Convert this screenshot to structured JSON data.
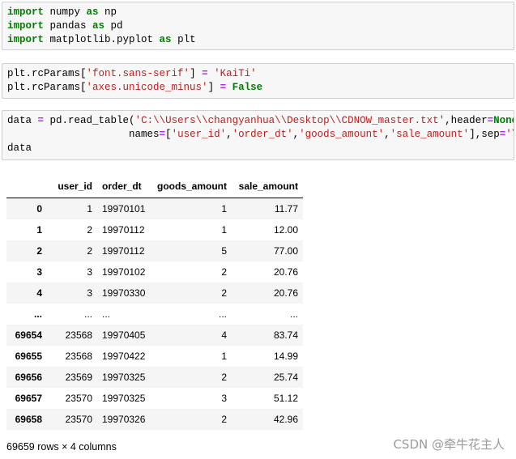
{
  "cells": [
    {
      "lines": [
        [
          [
            "kw",
            "import"
          ],
          [
            "t",
            " numpy "
          ],
          [
            "kw",
            "as"
          ],
          [
            "t",
            " np"
          ]
        ],
        [
          [
            "kw",
            "import"
          ],
          [
            "t",
            " pandas "
          ],
          [
            "kw",
            "as"
          ],
          [
            "t",
            " pd"
          ]
        ],
        [
          [
            "kw",
            "import"
          ],
          [
            "t",
            " matplotlib.pyplot "
          ],
          [
            "kw",
            "as"
          ],
          [
            "t",
            " plt"
          ]
        ]
      ]
    },
    {
      "lines": [
        [
          [
            "t",
            "plt.rcParams["
          ],
          [
            "str",
            "'font.sans-serif'"
          ],
          [
            "t",
            "] "
          ],
          [
            "op",
            "="
          ],
          [
            "t",
            " "
          ],
          [
            "str",
            "'KaiTi'"
          ]
        ],
        [
          [
            "t",
            "plt.rcParams["
          ],
          [
            "str",
            "'axes.unicode_minus'"
          ],
          [
            "t",
            "] "
          ],
          [
            "op",
            "="
          ],
          [
            "t",
            " "
          ],
          [
            "kwc",
            "False"
          ]
        ]
      ]
    },
    {
      "lines": [
        [
          [
            "t",
            "data "
          ],
          [
            "op",
            "="
          ],
          [
            "t",
            " pd.read_table("
          ],
          [
            "str",
            "'C:\\\\Users\\\\changyanhua\\\\Desktop\\\\CDNOW_master.txt'"
          ],
          [
            "t",
            ",header"
          ],
          [
            "op",
            "="
          ],
          [
            "kwc",
            "None"
          ],
          [
            "t",
            ","
          ]
        ],
        [
          [
            "t",
            "                    names"
          ],
          [
            "op",
            "="
          ],
          [
            "t",
            "["
          ],
          [
            "str",
            "'user_id'"
          ],
          [
            "t",
            ","
          ],
          [
            "str",
            "'order_dt'"
          ],
          [
            "t",
            ","
          ],
          [
            "str",
            "'goods_amount'"
          ],
          [
            "t",
            ","
          ],
          [
            "str",
            "'sale_amount'"
          ],
          [
            "t",
            "],sep"
          ],
          [
            "op",
            "="
          ],
          [
            "str",
            "'\\s+'"
          ],
          [
            "t",
            ")"
          ]
        ],
        [
          [
            "t",
            "data"
          ]
        ]
      ]
    }
  ],
  "table": {
    "columns": [
      "",
      "user_id",
      "order_dt",
      "goods_amount",
      "sale_amount"
    ],
    "rows": [
      [
        "0",
        "1",
        "19970101",
        "1",
        "11.77"
      ],
      [
        "1",
        "2",
        "19970112",
        "1",
        "12.00"
      ],
      [
        "2",
        "2",
        "19970112",
        "5",
        "77.00"
      ],
      [
        "3",
        "3",
        "19970102",
        "2",
        "20.76"
      ],
      [
        "4",
        "3",
        "19970330",
        "2",
        "20.76"
      ],
      [
        "...",
        "...",
        "...",
        "...",
        "..."
      ],
      [
        "69654",
        "23568",
        "19970405",
        "4",
        "83.74"
      ],
      [
        "69655",
        "23568",
        "19970422",
        "1",
        "14.99"
      ],
      [
        "69656",
        "23569",
        "19970325",
        "2",
        "25.74"
      ],
      [
        "69657",
        "23570",
        "19970325",
        "3",
        "51.12"
      ],
      [
        "69658",
        "23570",
        "19970326",
        "2",
        "42.96"
      ]
    ]
  },
  "shape_text": "69659 rows × 4 columns",
  "watermark": "CSDN @牵牛花主人",
  "colors": {
    "keyword": "#008000",
    "string": "#ba2121",
    "operator": "#aa22ff",
    "cell_bg": "#f7f7f7"
  }
}
